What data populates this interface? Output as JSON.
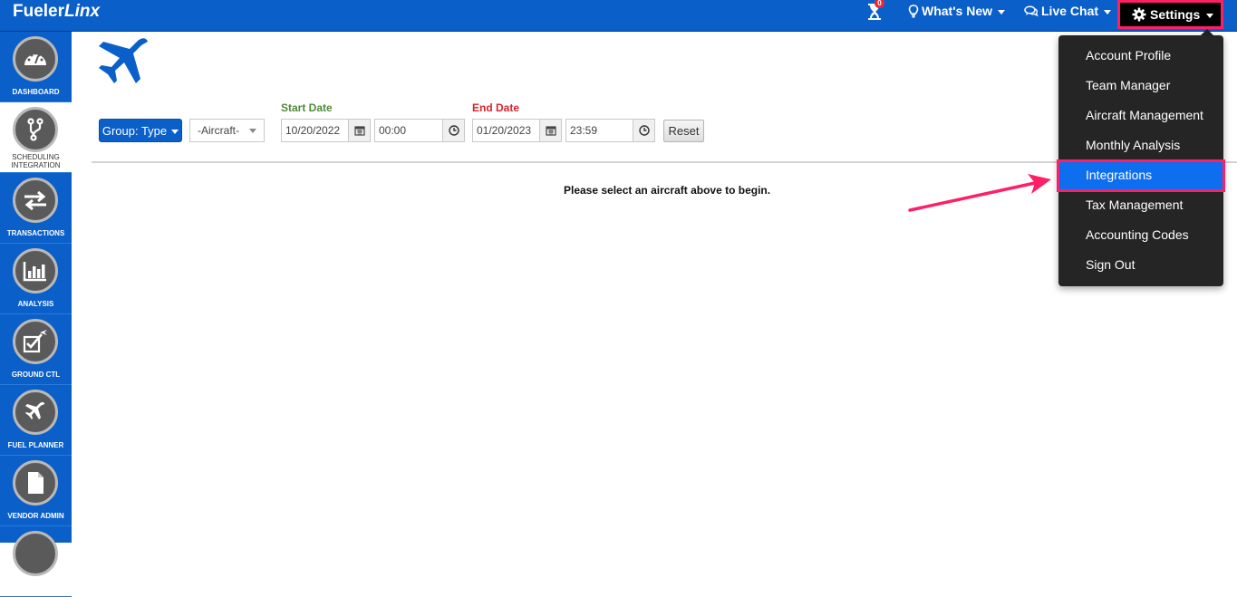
{
  "header": {
    "logo_main": "Fueler",
    "logo_italic": "Linx",
    "hourglass_badge": "0",
    "whats_new": "What's New",
    "live_chat": "Live Chat",
    "settings": "Settings"
  },
  "sidebar": {
    "items": [
      {
        "label": "DASHBOARD",
        "icon": "gauge-icon"
      },
      {
        "label_line1": "SCHEDULING",
        "label_line2": "INTEGRATION",
        "icon": "branch-icon"
      },
      {
        "label": "TRANSACTIONS",
        "icon": "swap-arrows-icon"
      },
      {
        "label": "ANALYSIS",
        "icon": "bar-chart-icon"
      },
      {
        "label": "GROUND CTL",
        "icon": "checklist-plane-icon"
      },
      {
        "label": "FUEL PLANNER",
        "icon": "plane-icon"
      },
      {
        "label": "VENDOR ADMIN",
        "icon": "document-icon"
      }
    ]
  },
  "filters": {
    "group_button": "Group: Type",
    "aircraft_select": "-Aircraft-",
    "start_date_label": "Start Date",
    "start_date": "10/20/2022",
    "start_time": "00:00",
    "end_date_label": "End Date",
    "end_date": "01/20/2023",
    "end_time": "23:59",
    "reset": "Reset"
  },
  "main": {
    "hint": "Please select an aircraft above to begin."
  },
  "settings_menu": {
    "items": [
      {
        "label": "Account Profile"
      },
      {
        "label": "Team Manager"
      },
      {
        "label": "Aircraft Management"
      },
      {
        "label": "Monthly Analysis"
      },
      {
        "label": "Integrations"
      },
      {
        "label": "Tax Management"
      },
      {
        "label": "Accounting Codes"
      },
      {
        "label": "Sign Out"
      }
    ],
    "active_index": 4
  },
  "colors": {
    "brand_blue": "#0a5fc9",
    "highlight_pink": "#ff1f66",
    "menu_bg": "#252525",
    "menu_active": "#0d6ef0",
    "start_date_label": "#4f8a3b",
    "end_date_label": "#d9232d"
  }
}
